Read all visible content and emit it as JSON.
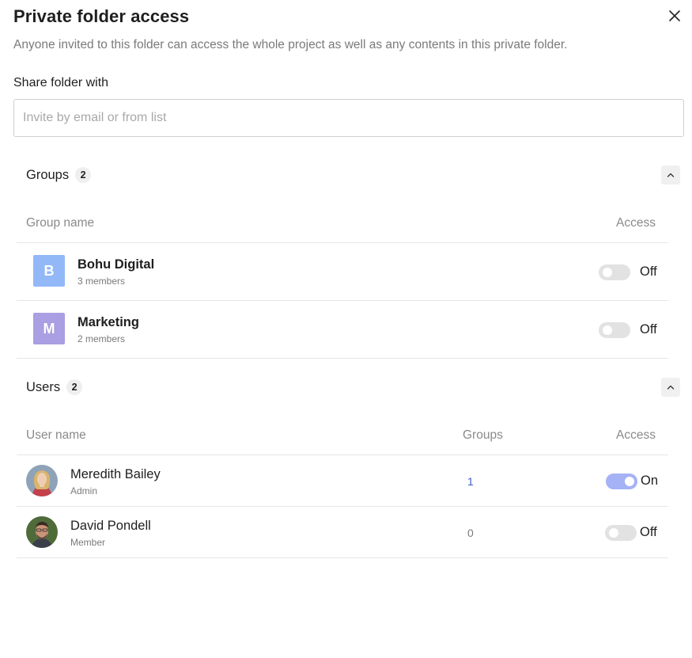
{
  "dialog": {
    "title": "Private folder access",
    "description": "Anyone invited to this folder can access the whole project as well as any contents in this private folder.",
    "share_label": "Share folder with",
    "invite_placeholder": "Invite by email or from list"
  },
  "groups_section": {
    "title": "Groups",
    "count": "2",
    "columns": {
      "name": "Group name",
      "access": "Access"
    },
    "rows": [
      {
        "initial": "B",
        "name": "Bohu Digital",
        "members": "3 members",
        "access": "Off",
        "color": "#93b8f7"
      },
      {
        "initial": "M",
        "name": "Marketing",
        "members": "2 members",
        "access": "Off",
        "color": "#a99fe2"
      }
    ]
  },
  "users_section": {
    "title": "Users",
    "count": "2",
    "columns": {
      "name": "User name",
      "groups": "Groups",
      "access": "Access"
    },
    "rows": [
      {
        "name": "Meredith Bailey",
        "role": "Admin",
        "groups": "1",
        "access": "On"
      },
      {
        "name": "David Pondell",
        "role": "Member",
        "groups": "0",
        "access": "Off"
      }
    ]
  },
  "colors": {
    "toggle_on": "#a5b2f5",
    "toggle_off": "#e2e2e2",
    "link_blue": "#3b5bc8"
  }
}
